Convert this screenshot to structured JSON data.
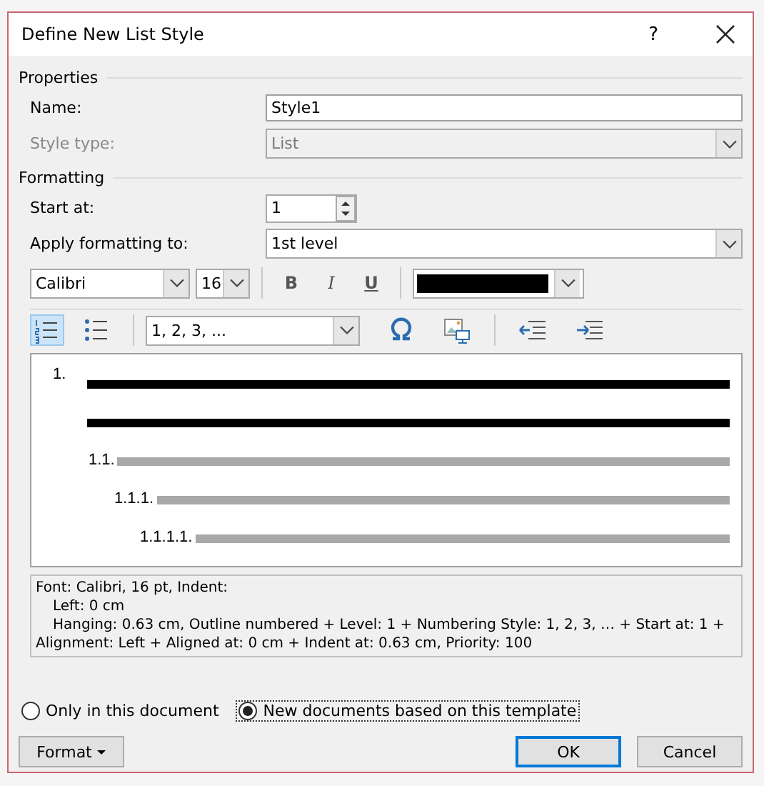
{
  "window": {
    "title": "Define New List Style",
    "help": "?"
  },
  "properties": {
    "heading": "Properties",
    "name": {
      "label": "Name:",
      "value": "Style1"
    },
    "style_type": {
      "label": "Style type:",
      "value": "List",
      "disabled": true
    }
  },
  "formatting": {
    "heading": "Formatting",
    "start_at": {
      "label": "Start at:",
      "value": "1"
    },
    "apply_to": {
      "label": "Apply formatting to:",
      "value": "1st level"
    },
    "font": "Calibri",
    "size": "16",
    "styles": [
      {
        "label": "B",
        "kind": "bold",
        "selected": false
      },
      {
        "label": "I",
        "kind": "italic",
        "selected": false
      },
      {
        "label": "U",
        "kind": "underline",
        "selected": false
      }
    ],
    "list_types": [
      {
        "kind": "numbered",
        "selected": true
      },
      {
        "kind": "bulleted",
        "selected": false
      }
    ],
    "number_style": "1, 2, 3, ..."
  },
  "preview": {
    "levels": [
      {
        "number": "1.",
        "current": true
      },
      {
        "number": "1.1.",
        "current": false
      },
      {
        "number": "1.1.1.",
        "current": false
      },
      {
        "number": "1.1.1.1.",
        "current": false
      }
    ]
  },
  "description": [
    "Font: Calibri, 16 pt, Indent:",
    "Left:  0 cm",
    "Hanging:  0.63 cm, Outline numbered + Level: 1 + Numbering Style: 1, 2, 3, … + Start at: 1 + Alignment: Left + Aligned at:  0 cm + Indent at:  0.63 cm, Priority: 100"
  ],
  "scope": [
    {
      "label": "Only in this document",
      "selected": false
    },
    {
      "label": "New documents based on this template",
      "selected": true
    }
  ],
  "buttons": [
    {
      "label": "Format",
      "kind": "menu"
    },
    {
      "label": "OK",
      "kind": "default"
    },
    {
      "label": "Cancel",
      "kind": "normal"
    }
  ]
}
